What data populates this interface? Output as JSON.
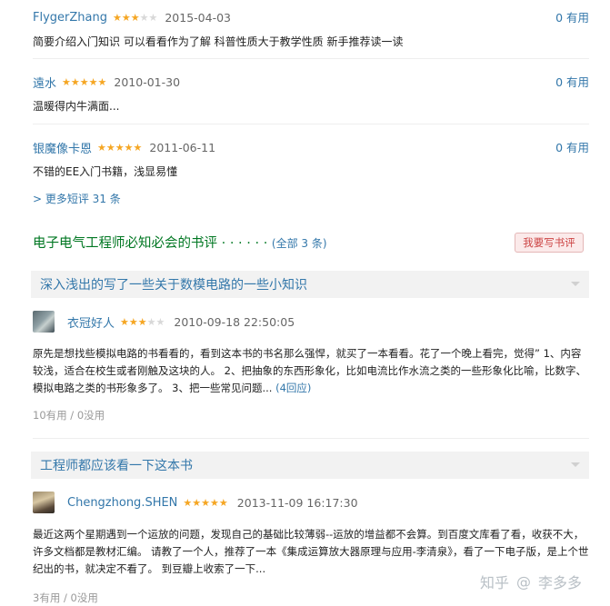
{
  "comments": [
    {
      "user": "FlygerZhang",
      "rating": 3,
      "date": "2015-04-03",
      "useful": "0 有用",
      "text": "简要介绍入门知识 可以看看作为了解 科普性质大于教学性质 新手推荐读一读"
    },
    {
      "user": "遠水",
      "rating": 5,
      "date": "2010-01-30",
      "useful": "0 有用",
      "text": "温暖得内牛满面..."
    },
    {
      "user": "银魔像卡恩",
      "rating": 5,
      "date": "2011-06-11",
      "useful": "0 有用",
      "text": "不错的EE入门书籍，浅显易懂"
    }
  ],
  "more_comments": "> 更多短评 31 条",
  "section": {
    "title": "电子电气工程师必知必会的书评",
    "dots": " · · · · · · ",
    "count": "(全部 3 条)",
    "write_button": "我要写书评"
  },
  "reviews": [
    {
      "title": "深入浅出的写了一些关于数模电路的一些小知识",
      "user": "衣冠好人",
      "rating": 3,
      "datetime": "2010-09-18 22:50:05",
      "body": "原先是想找些模拟电路的书看看的，看到这本书的书名那么强悍，就买了一本看看。花了一个晚上看完，觉得” 1、内容较浅，适合在校生或者刚触及这块的人。 2、把抽象的东西形象化，比如电流比作水流之类的一些形象化比喻，比数字、模拟电路之类的书形象多了。 3、把一些常见问题...",
      "reply": "(4回应)",
      "votes": "10有用 / 0没用"
    },
    {
      "title": "工程师都应该看一下这本书",
      "user": "Chengzhong.SHEN",
      "rating": 5,
      "datetime": "2013-11-09 16:17:30",
      "body": "最近这两个星期遇到一个运放的问题，发现自己的基础比较薄弱--运放的增益都不会算。到百度文库看了看，收获不大，许多文档都是教材汇编。 请教了一个人，推荐了一本《集成运算放大器原理与应用-李清泉》，看了一下电子版，是上个世纪出的书，就决定不看了。 到豆瓣上收索了一下...",
      "votes": "3有用 / 0没用"
    }
  ],
  "watermark": {
    "brand": "知乎",
    "sep": "@",
    "author": "李多多"
  },
  "colors": {
    "link": "#3377aa",
    "section": "#007722",
    "star": "#f5a623"
  }
}
